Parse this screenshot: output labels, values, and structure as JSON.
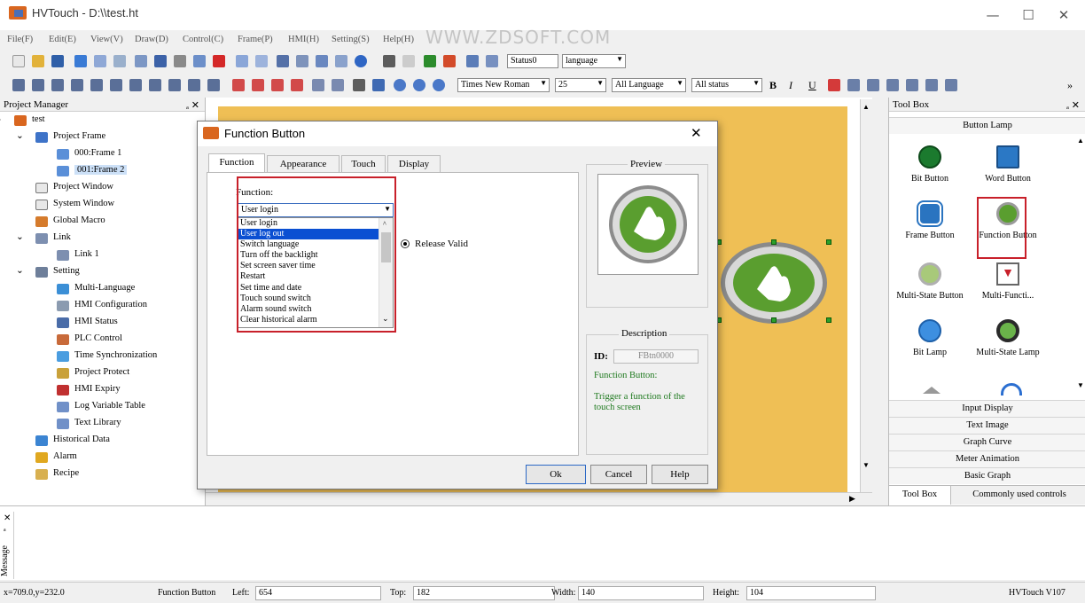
{
  "window": {
    "title": "HVTouch - D:\\\\test.ht",
    "minimize": "—",
    "maximize": "☐",
    "close": "✕"
  },
  "watermark": "WWW.ZDSOFT.COM",
  "menu": [
    "File(F)",
    "Edit(E)",
    "View(V)",
    "Draw(D)",
    "Control(C)",
    "Frame(P)",
    "HMI(H)",
    "Setting(S)",
    "Help(H)"
  ],
  "toolbar1": {
    "status_combo": "Status0",
    "language_combo": "language"
  },
  "toolbar2": {
    "font_combo": "Times New Roman",
    "size_combo": "25",
    "all_language": "All Language",
    "all_status": "All status",
    "bold": "B",
    "italic": "I",
    "underline": "U",
    "more": "»"
  },
  "project_manager": {
    "title": "Project Manager",
    "pin": "ₐ ✕",
    "tree": [
      {
        "label": "test",
        "level": 0,
        "icon": "project-icon"
      },
      {
        "label": "Project Frame",
        "level": 1,
        "icon": "frame-folder-icon"
      },
      {
        "label": "000:Frame 1",
        "level": 2,
        "icon": "frame-icon"
      },
      {
        "label": "001:Frame 2",
        "level": 2,
        "icon": "frame-icon"
      },
      {
        "label": "Project Window",
        "level": 1,
        "icon": "window-icon"
      },
      {
        "label": "System Window",
        "level": 1,
        "icon": "window-icon"
      },
      {
        "label": "Global Macro",
        "level": 1,
        "icon": "macro-icon"
      },
      {
        "label": "Link",
        "level": 1,
        "icon": "link-icon"
      },
      {
        "label": "Link 1",
        "level": 2,
        "icon": "link-icon"
      },
      {
        "label": "Setting",
        "level": 1,
        "icon": "setting-icon"
      },
      {
        "label": "Multi-Language",
        "level": 2,
        "icon": "globe-icon"
      },
      {
        "label": "HMI Configuration",
        "level": 2,
        "icon": "gear-icon"
      },
      {
        "label": "HMI Status",
        "level": 2,
        "icon": "status-icon"
      },
      {
        "label": "PLC Control",
        "level": 2,
        "icon": "plc-icon"
      },
      {
        "label": "Time Synchronization",
        "level": 2,
        "icon": "clock-icon"
      },
      {
        "label": "Project Protect",
        "level": 2,
        "icon": "lock-icon"
      },
      {
        "label": "HMI Expiry",
        "level": 2,
        "icon": "expiry-icon"
      },
      {
        "label": "Log Variable Table",
        "level": 2,
        "icon": "table-icon"
      },
      {
        "label": "Text Library",
        "level": 2,
        "icon": "table-icon"
      },
      {
        "label": "Historical Data",
        "level": 1,
        "icon": "history-icon"
      },
      {
        "label": "Alarm",
        "level": 1,
        "icon": "alarm-icon"
      },
      {
        "label": "Recipe",
        "level": 1,
        "icon": "recipe-icon"
      }
    ]
  },
  "dialog": {
    "title": "Function Button",
    "close": "✕",
    "tabs": [
      "Function",
      "Appearance",
      "Touch",
      "Display"
    ],
    "function_label": "Function:",
    "function_value": "User login",
    "options": [
      "User login",
      "User log out",
      "Switch language",
      "Turn off the backlight",
      "Set screen saver time",
      "Restart",
      "Set time and date",
      "Touch sound switch",
      "Alarm sound switch",
      "Clear historical alarm"
    ],
    "highlighted_index": 1,
    "release_valid": "Release Valid",
    "preview_label": "Preview",
    "description_label": "Description",
    "id_label": "ID:",
    "id_value": "FBtn0000",
    "desc_heading": "Function Button:",
    "desc_text": "Trigger a function of the touch screen",
    "ok": "Ok",
    "cancel": "Cancel",
    "help": "Help"
  },
  "toolbox": {
    "title": "Tool Box",
    "pin": "ₐ ✕",
    "section_top": "Button Lamp",
    "items": [
      "Bit Button",
      "Word Button",
      "Frame Button",
      "Function Button",
      "Multi-State Button",
      "Multi-Functi...",
      "Bit Lamp",
      "Multi-State Lamp"
    ],
    "sections": [
      "Input Display",
      "Text Image",
      "Graph Curve",
      "Meter Animation",
      "Basic Graph"
    ],
    "bottom_tabs": [
      "Tool Box",
      "Commonly used controls"
    ]
  },
  "message_panel": {
    "label": "Message",
    "controls": "✕ ₐ"
  },
  "status": {
    "coords": "x=709.0,y=232.0",
    "object": "Function Button",
    "left_label": "Left:",
    "left_value": "654",
    "top_label": "Top:",
    "top_value": "182",
    "width_label": "Width:",
    "width_value": "140",
    "height_label": "Height:",
    "height_value": "104",
    "app_version": "HVTouch V107"
  },
  "colors": {
    "accent": "#0a4fd2",
    "canvas": "#efbf55",
    "highlight_box": "#c8202a",
    "button_green": "#5a9e2f"
  }
}
